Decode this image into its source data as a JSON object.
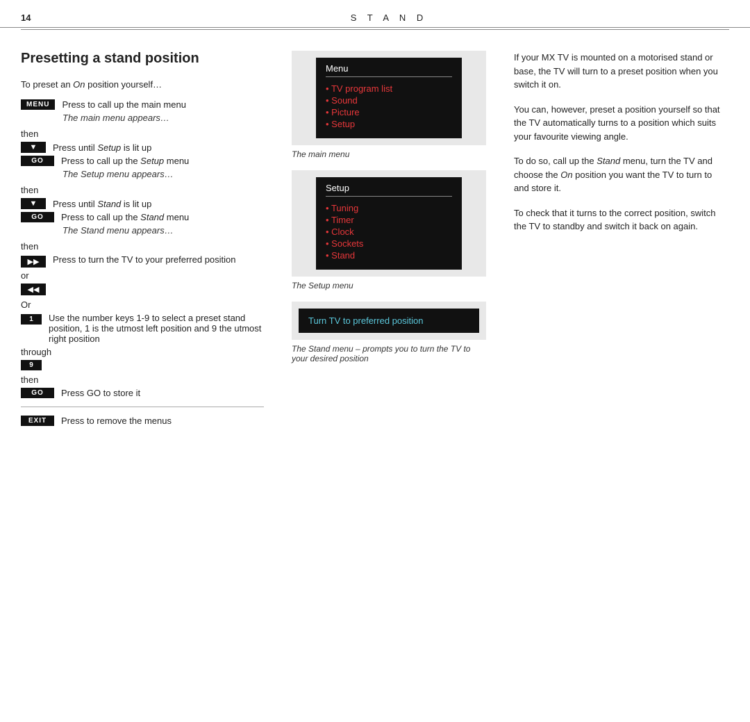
{
  "header": {
    "page_number": "14",
    "title": "S T A N D"
  },
  "left": {
    "section_title": "Presetting a stand position",
    "intro_text": "To preset an On position yourself…",
    "steps": [
      {
        "type": "button",
        "btn": "MENU",
        "desc": "Press to call up the main menu"
      },
      {
        "type": "note",
        "text": "The main menu appears…"
      },
      {
        "type": "label",
        "text": "then"
      },
      {
        "type": "arrow_down",
        "desc": "Press until Setup is lit up"
      },
      {
        "type": "button",
        "btn": "GO",
        "desc": "Press to call up the Setup menu"
      },
      {
        "type": "note",
        "text": "The Setup menu appears…"
      },
      {
        "type": "label",
        "text": "then"
      },
      {
        "type": "arrow_down",
        "desc": "Press until Stand is lit up"
      },
      {
        "type": "button",
        "btn": "GO",
        "desc": "Press to call up the Stand menu"
      },
      {
        "type": "note",
        "text": "The Stand menu appears…"
      },
      {
        "type": "label",
        "text": "then"
      },
      {
        "type": "arrow_fwd",
        "desc": "Press to turn the TV to your preferred position"
      },
      {
        "type": "or_label",
        "text": "or"
      },
      {
        "type": "arrow_back"
      },
      {
        "type": "or_label",
        "text": "Or"
      },
      {
        "type": "number_btn",
        "btn": "1",
        "desc": "Use the number keys 1-9 to select a preset stand position, 1 is the utmost left position and 9 the utmost right position"
      },
      {
        "type": "label",
        "text": "through"
      },
      {
        "type": "number_btn",
        "btn": "9"
      },
      {
        "type": "label",
        "text": "then"
      },
      {
        "type": "button",
        "btn": "GO",
        "desc": "Press GO to store it"
      }
    ],
    "exit": {
      "btn": "EXIT",
      "desc": "Press to remove the menus"
    }
  },
  "middle": {
    "main_menu": {
      "title": "Menu",
      "items": [
        {
          "text": "TV program list",
          "color": "red"
        },
        {
          "text": "Sound",
          "color": "red"
        },
        {
          "text": "Picture",
          "color": "red"
        },
        {
          "text": "Setup",
          "color": "red"
        }
      ],
      "caption": "The main menu"
    },
    "setup_menu": {
      "title": "Setup",
      "items": [
        {
          "text": "Tuning",
          "color": "red"
        },
        {
          "text": "Timer",
          "color": "red"
        },
        {
          "text": "Clock",
          "color": "red"
        },
        {
          "text": "Sockets",
          "color": "red"
        },
        {
          "text": "Stand",
          "color": "red"
        }
      ],
      "caption": "The Setup menu"
    },
    "stand_menu": {
      "bar_text": "Turn TV to preferred position",
      "caption": "The Stand menu – prompts you to turn the TV to your desired position"
    }
  },
  "right": {
    "paragraphs": [
      "If your MX TV is mounted on a motorised stand or base, the TV will turn to a preset position when you switch it on.",
      "You can, however, preset a position yourself so that the TV automatically turns to a position which suits your favourite viewing angle.",
      "To do so, call up the Stand menu, turn the TV and choose the On position you want the TV to turn to and store it.",
      "To check that it turns to the correct position, switch the TV to standby and switch it back on again."
    ]
  }
}
